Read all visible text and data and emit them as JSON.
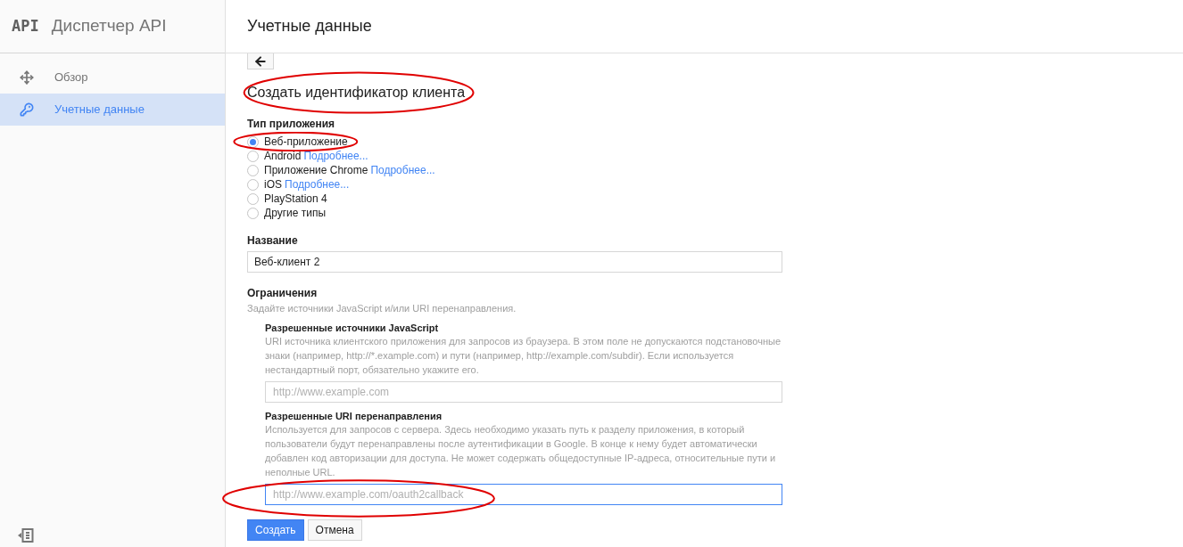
{
  "app": {
    "logo": "API",
    "title": "Диспетчер API"
  },
  "sidebar": {
    "items": [
      {
        "label": "Обзор",
        "selected": false
      },
      {
        "label": "Учетные данные",
        "selected": true
      }
    ]
  },
  "page_title": "Учетные данные",
  "form": {
    "heading": "Создать идентификатор клиента",
    "app_type": {
      "label": "Тип приложения",
      "options": [
        {
          "label": "Веб-приложение",
          "selected": true
        },
        {
          "label": "Android",
          "link": "Подробнее...",
          "selected": false
        },
        {
          "label": "Приложение Chrome",
          "link": "Подробнее...",
          "selected": false
        },
        {
          "label": "iOS",
          "link": "Подробнее...",
          "selected": false
        },
        {
          "label": "PlayStation 4",
          "selected": false
        },
        {
          "label": "Другие типы",
          "selected": false
        }
      ]
    },
    "name": {
      "label": "Название",
      "value": "Веб-клиент 2"
    },
    "restrictions": {
      "label": "Ограничения",
      "hint": "Задайте источники JavaScript и/или URI перенаправления.",
      "sections": [
        {
          "title": "Разрешенные источники JavaScript",
          "hint": "URI источника клиентского приложения для запросов из браузера. В этом поле не допускаются подстановочные знаки (например, http://*.example.com) и пути (например, http://example.com/subdir). Если используется нестандартный порт, обязательно укажите его.",
          "placeholder": "http://www.example.com",
          "focused": false
        },
        {
          "title": "Разрешенные URI перенаправления",
          "hint": "Используется для запросов с сервера. Здесь необходимо указать путь к разделу приложения, в который пользователи будут перенаправлены после аутентификации в Google. В конце к нему будет автоматически добавлен код авторизации для доступа. Не может содержать общедоступные IP-адреса, относительные пути и неполные URL.",
          "placeholder": "http://www.example.com/oauth2callback",
          "focused": true
        }
      ]
    },
    "buttons": [
      {
        "label": "Создать",
        "kind": "primary"
      },
      {
        "label": "Отмена",
        "kind": "secondary"
      }
    ]
  }
}
